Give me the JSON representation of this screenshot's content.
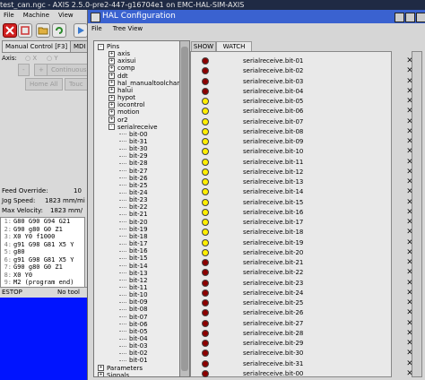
{
  "axis": {
    "title": "test_can.ngc - AXIS 2.5.0-pre2-447-g16704e1 on EMC-HAL-SIM-AXIS",
    "menu": [
      "File",
      "Machine",
      "View"
    ],
    "tabs": [
      "Manual Control [F3]",
      "MDI"
    ],
    "axis_label": "Axis:",
    "axis_options": [
      "X",
      "Y"
    ],
    "continuous_label": "Continuous",
    "home_all_label": "Home All",
    "touch_label": "Touc",
    "feed_override_label": "Feed Override:",
    "feed_override_value": "10",
    "jog_speed_label": "Jog Speed:",
    "jog_speed_value": "1823 mm/mi",
    "max_velocity_label": "Max Velocity:",
    "max_velocity_value": "1823 mm/",
    "gcode": [
      {
        "n": "1:",
        "t": "G80 G90 G94 G21"
      },
      {
        "n": "2:",
        "t": "G90 g80 G0 Z1"
      },
      {
        "n": "3:",
        "t": "X0 Y0 f1000"
      },
      {
        "n": "4:",
        "t": "g91 G98 G81 X5 Y"
      },
      {
        "n": "5:",
        "t": "g80"
      },
      {
        "n": "6:",
        "t": "g91 G98 G81 X5 Y"
      },
      {
        "n": "7:",
        "t": "G90 g80 G0 Z1"
      },
      {
        "n": "8:",
        "t": "X0 Y0"
      },
      {
        "n": "9:",
        "t": "M2 (program end)"
      }
    ],
    "status_estop": "ESTOP",
    "status_tool": "No tool"
  },
  "hal": {
    "title": "HAL Configuration",
    "menu": [
      "File",
      "Tree View"
    ],
    "tree": [
      {
        "label": "Pins",
        "indent": 0,
        "expander": "-"
      },
      {
        "label": "axis",
        "indent": 1,
        "expander": "+"
      },
      {
        "label": "axisui",
        "indent": 1,
        "expander": "+"
      },
      {
        "label": "comp",
        "indent": 1,
        "expander": "+"
      },
      {
        "label": "ddt",
        "indent": 1,
        "expander": "+"
      },
      {
        "label": "hal_manualtoolchang",
        "indent": 1,
        "expander": "+"
      },
      {
        "label": "halui",
        "indent": 1,
        "expander": "+"
      },
      {
        "label": "hypot",
        "indent": 1,
        "expander": "+"
      },
      {
        "label": "iocontrol",
        "indent": 1,
        "expander": "+"
      },
      {
        "label": "motion",
        "indent": 1,
        "expander": "+"
      },
      {
        "label": "or2",
        "indent": 1,
        "expander": "+"
      },
      {
        "label": "serialreceive",
        "indent": 1,
        "expander": "-"
      },
      {
        "label": "bit-00",
        "indent": 2,
        "expander": ""
      },
      {
        "label": "bit-31",
        "indent": 2,
        "expander": ""
      },
      {
        "label": "bit-30",
        "indent": 2,
        "expander": ""
      },
      {
        "label": "bit-29",
        "indent": 2,
        "expander": ""
      },
      {
        "label": "bit-28",
        "indent": 2,
        "expander": ""
      },
      {
        "label": "bit-27",
        "indent": 2,
        "expander": ""
      },
      {
        "label": "bit-26",
        "indent": 2,
        "expander": ""
      },
      {
        "label": "bit-25",
        "indent": 2,
        "expander": ""
      },
      {
        "label": "bit-24",
        "indent": 2,
        "expander": ""
      },
      {
        "label": "bit-23",
        "indent": 2,
        "expander": ""
      },
      {
        "label": "bit-22",
        "indent": 2,
        "expander": ""
      },
      {
        "label": "bit-21",
        "indent": 2,
        "expander": ""
      },
      {
        "label": "bit-20",
        "indent": 2,
        "expander": ""
      },
      {
        "label": "bit-19",
        "indent": 2,
        "expander": ""
      },
      {
        "label": "bit-18",
        "indent": 2,
        "expander": ""
      },
      {
        "label": "bit-17",
        "indent": 2,
        "expander": ""
      },
      {
        "label": "bit-16",
        "indent": 2,
        "expander": ""
      },
      {
        "label": "bit-15",
        "indent": 2,
        "expander": ""
      },
      {
        "label": "bit-14",
        "indent": 2,
        "expander": ""
      },
      {
        "label": "bit-13",
        "indent": 2,
        "expander": ""
      },
      {
        "label": "bit-12",
        "indent": 2,
        "expander": ""
      },
      {
        "label": "bit-11",
        "indent": 2,
        "expander": ""
      },
      {
        "label": "bit-10",
        "indent": 2,
        "expander": ""
      },
      {
        "label": "bit-09",
        "indent": 2,
        "expander": ""
      },
      {
        "label": "bit-08",
        "indent": 2,
        "expander": ""
      },
      {
        "label": "bit-07",
        "indent": 2,
        "expander": ""
      },
      {
        "label": "bit-06",
        "indent": 2,
        "expander": ""
      },
      {
        "label": "bit-05",
        "indent": 2,
        "expander": ""
      },
      {
        "label": "bit-04",
        "indent": 2,
        "expander": ""
      },
      {
        "label": "bit-03",
        "indent": 2,
        "expander": ""
      },
      {
        "label": "bit-02",
        "indent": 2,
        "expander": ""
      },
      {
        "label": "bit-01",
        "indent": 2,
        "expander": ""
      },
      {
        "label": "Parameters",
        "indent": 0,
        "expander": "+"
      },
      {
        "label": "Signals",
        "indent": 0,
        "expander": "+"
      }
    ],
    "tabs": {
      "show": "SHOW",
      "watch": "WATCH"
    },
    "led_colors": {
      "on": "#ffee00",
      "off": "#8b0000"
    },
    "watch": [
      {
        "label": "serialreceive.bit-01",
        "state": "off"
      },
      {
        "label": "serialreceive.bit-02",
        "state": "off"
      },
      {
        "label": "serialreceive.bit-03",
        "state": "off"
      },
      {
        "label": "serialreceive.bit-04",
        "state": "off"
      },
      {
        "label": "serialreceive.bit-05",
        "state": "on"
      },
      {
        "label": "serialreceive.bit-06",
        "state": "on"
      },
      {
        "label": "serialreceive.bit-07",
        "state": "on"
      },
      {
        "label": "serialreceive.bit-08",
        "state": "on"
      },
      {
        "label": "serialreceive.bit-09",
        "state": "on"
      },
      {
        "label": "serialreceive.bit-10",
        "state": "on"
      },
      {
        "label": "serialreceive.bit-11",
        "state": "on"
      },
      {
        "label": "serialreceive.bit-12",
        "state": "on"
      },
      {
        "label": "serialreceive.bit-13",
        "state": "on"
      },
      {
        "label": "serialreceive.bit-14",
        "state": "on"
      },
      {
        "label": "serialreceive.bit-15",
        "state": "on"
      },
      {
        "label": "serialreceive.bit-16",
        "state": "on"
      },
      {
        "label": "serialreceive.bit-17",
        "state": "on"
      },
      {
        "label": "serialreceive.bit-18",
        "state": "on"
      },
      {
        "label": "serialreceive.bit-19",
        "state": "on"
      },
      {
        "label": "serialreceive.bit-20",
        "state": "on"
      },
      {
        "label": "serialreceive.bit-21",
        "state": "off"
      },
      {
        "label": "serialreceive.bit-22",
        "state": "off"
      },
      {
        "label": "serialreceive.bit-23",
        "state": "off"
      },
      {
        "label": "serialreceive.bit-24",
        "state": "off"
      },
      {
        "label": "serialreceive.bit-25",
        "state": "off"
      },
      {
        "label": "serialreceive.bit-26",
        "state": "off"
      },
      {
        "label": "serialreceive.bit-27",
        "state": "off"
      },
      {
        "label": "serialreceive.bit-28",
        "state": "off"
      },
      {
        "label": "serialreceive.bit-29",
        "state": "off"
      },
      {
        "label": "serialreceive.bit-30",
        "state": "off"
      },
      {
        "label": "serialreceive.bit-31",
        "state": "off"
      },
      {
        "label": "serialreceive.bit-00",
        "state": "off"
      }
    ]
  }
}
